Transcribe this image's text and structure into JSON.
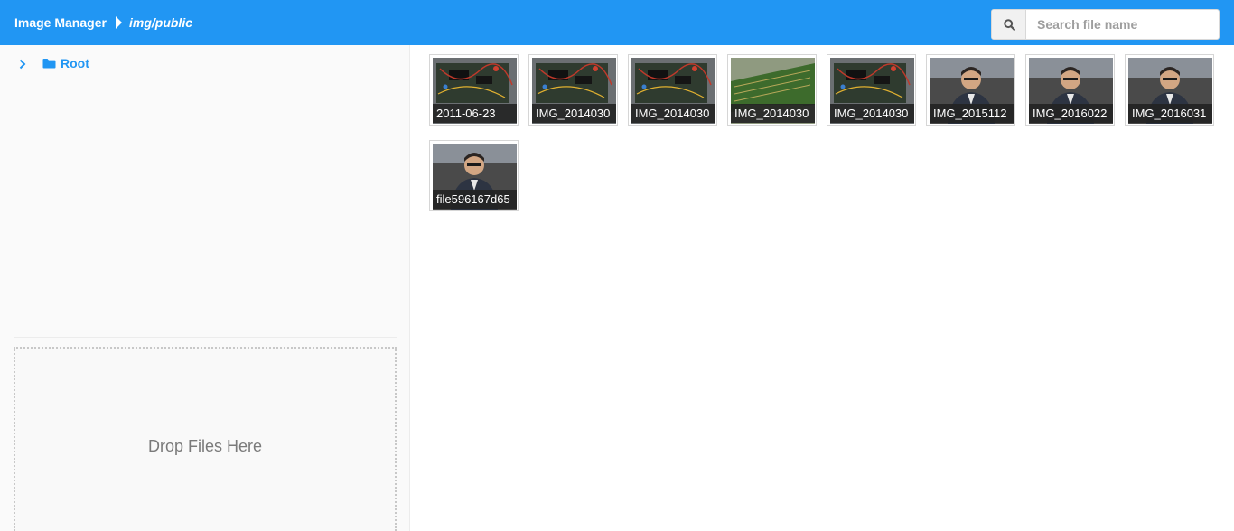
{
  "header": {
    "title": "Image Manager",
    "path": "img/public",
    "accent_color": "#2196f3",
    "search": {
      "placeholder": "Search file name",
      "value": "",
      "icon": "search-icon"
    }
  },
  "sidebar": {
    "tree": [
      {
        "label": "Root",
        "expand_icon": "chevron-right-icon",
        "folder_icon": "folder-icon"
      }
    ],
    "dropzone": {
      "text": "Drop Files Here"
    }
  },
  "files": [
    {
      "name": "2011-06-23",
      "kind": "circuit"
    },
    {
      "name": "IMG_2014030",
      "kind": "circuit"
    },
    {
      "name": "IMG_2014030",
      "kind": "circuit"
    },
    {
      "name": "IMG_2014030",
      "kind": "pcb"
    },
    {
      "name": "IMG_2014030",
      "kind": "circuit"
    },
    {
      "name": "IMG_2015112",
      "kind": "portrait"
    },
    {
      "name": "IMG_2016022",
      "kind": "portrait"
    },
    {
      "name": "IMG_2016031",
      "kind": "portrait"
    },
    {
      "name": "file596167d65",
      "kind": "portrait"
    }
  ]
}
